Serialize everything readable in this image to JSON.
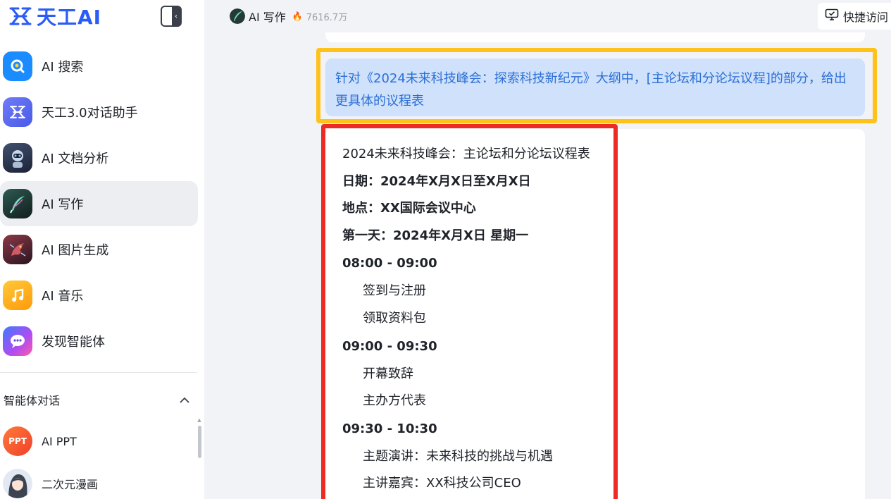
{
  "brand": {
    "name": "天工AI",
    "accent": "#2b5cf5"
  },
  "sidebar": {
    "items": [
      {
        "label": "AI 搜索",
        "icon": "search-icon",
        "color": "#1a8cff"
      },
      {
        "label": "天工3.0对话助手",
        "icon": "tiangong-logo-icon",
        "color": "#5b6cf5"
      },
      {
        "label": "AI 文档分析",
        "icon": "robot-icon",
        "color": "#2f3a56"
      },
      {
        "label": "AI 写作",
        "icon": "quill-icon",
        "color": "#1e3d3a",
        "active": true
      },
      {
        "label": "AI 图片生成",
        "icon": "dragon-icon",
        "color": "#5a2a36"
      },
      {
        "label": "AI 音乐",
        "icon": "music-note-icon",
        "color": "#ffb21a"
      },
      {
        "label": "发现智能体",
        "icon": "chat-bubble-icon",
        "color": "#8a4cf5"
      }
    ],
    "section": {
      "title": "智能体对话",
      "toggle": "^"
    },
    "agents": [
      {
        "label": "AI PPT",
        "avatar_text": "PPT",
        "color": "#f5562a"
      },
      {
        "label": "二次元漫画",
        "avatar_text": "",
        "color": "#c9d4e6"
      }
    ]
  },
  "header": {
    "app_name": "AI 写作",
    "heat": "7616.7万",
    "quick_access": "快捷访问"
  },
  "chat": {
    "question": "针对《2024未来科技峰会：探索科技新纪元》大纲中，[主论坛和分论坛议程]的部分，给出更具体的议程表",
    "answer": [
      {
        "text": "2024未来科技峰会：主论坛和分论坛议程表",
        "style": "normal"
      },
      {
        "text": "日期：2024年X月X日至X月X日",
        "style": "bold"
      },
      {
        "text": "地点：XX国际会议中心",
        "style": "bold"
      },
      {
        "text": "第一天：2024年X月X日 星期一",
        "style": "bold"
      },
      {
        "text": "08:00 - 09:00",
        "style": "time"
      },
      {
        "text": "签到与注册",
        "style": "indent"
      },
      {
        "text": "领取资料包",
        "style": "indent"
      },
      {
        "text": "09:00 - 09:30",
        "style": "time"
      },
      {
        "text": "开幕致辞",
        "style": "indent"
      },
      {
        "text": "主办方代表",
        "style": "indent"
      },
      {
        "text": "09:30 - 10:30",
        "style": "time"
      },
      {
        "text": "主题演讲：未来科技的挑战与机遇",
        "style": "indent"
      },
      {
        "text": "主讲嘉宾：XX科技公司CEO",
        "style": "indent"
      }
    ]
  },
  "highlight_colors": {
    "question": "#ffc21a",
    "answer": "#ee2a24"
  }
}
